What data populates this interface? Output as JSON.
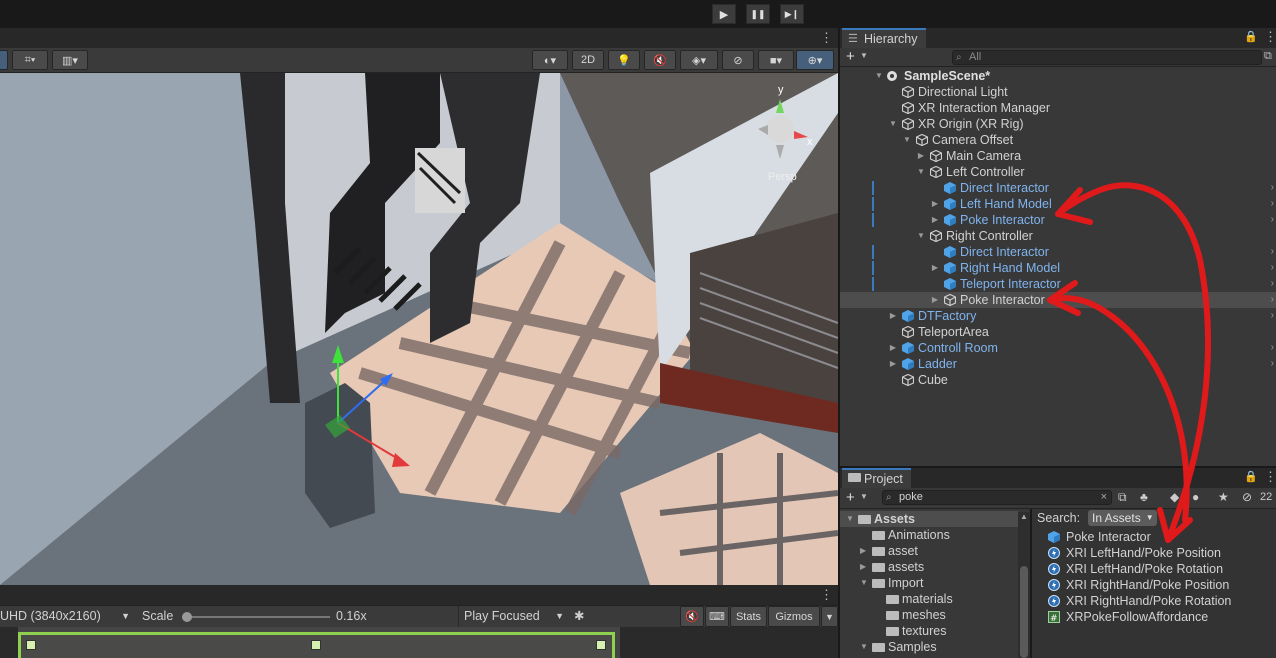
{
  "playbar": {
    "play": "▶",
    "pause": "❚❚",
    "step": "▶❙"
  },
  "scene_toolbar": {
    "btn_2d": "2D",
    "persp_label": "Persp",
    "gizmo_y": "y",
    "gizmo_x": "x"
  },
  "game_toolbar": {
    "resolution": "UHD (3840x2160)",
    "scale_label": "Scale",
    "scale_value": "0.16x",
    "play_mode": "Play Focused",
    "stats": "Stats",
    "gizmos": "Gizmos"
  },
  "hierarchy": {
    "tab": "Hierarchy",
    "search_placeholder": "All",
    "rows": [
      {
        "label": "SampleScene*"
      },
      {
        "label": "Directional Light"
      },
      {
        "label": "XR Interaction Manager"
      },
      {
        "label": "XR Origin (XR Rig)"
      },
      {
        "label": "Camera Offset"
      },
      {
        "label": "Main Camera"
      },
      {
        "label": "Left Controller"
      },
      {
        "label": "Direct Interactor"
      },
      {
        "label": "Left Hand Model"
      },
      {
        "label": "Poke Interactor"
      },
      {
        "label": "Right Controller"
      },
      {
        "label": "Direct Interactor"
      },
      {
        "label": "Right Hand Model"
      },
      {
        "label": "Teleport Interactor"
      },
      {
        "label": "Poke Interactor"
      },
      {
        "label": "DTFactory"
      },
      {
        "label": "TeleportArea"
      },
      {
        "label": "Controll Room"
      },
      {
        "label": "Ladder"
      },
      {
        "label": "Cube"
      }
    ]
  },
  "project": {
    "tab": "Project",
    "search_value": "poke",
    "count": "22",
    "search_label": "Search:",
    "search_scope": "In Assets",
    "tree": [
      {
        "label": "Assets"
      },
      {
        "label": "Animations"
      },
      {
        "label": "asset"
      },
      {
        "label": "assets"
      },
      {
        "label": "Import"
      },
      {
        "label": "materials"
      },
      {
        "label": "meshes"
      },
      {
        "label": "textures"
      },
      {
        "label": "Samples"
      }
    ],
    "results": [
      {
        "label": "Poke Interactor"
      },
      {
        "label": "XRI LeftHand/Poke Position"
      },
      {
        "label": "XRI LeftHand/Poke Rotation"
      },
      {
        "label": "XRI RightHand/Poke Position"
      },
      {
        "label": "XRI RightHand/Poke Rotation"
      },
      {
        "label": "XRPokeFollowAffordance"
      }
    ]
  },
  "colors": {
    "accent_blue": "#3a79bb",
    "prefab_blue": "#7fb4ee",
    "annotation_red": "#e01a1a",
    "selection_green": "#8fd14f"
  }
}
